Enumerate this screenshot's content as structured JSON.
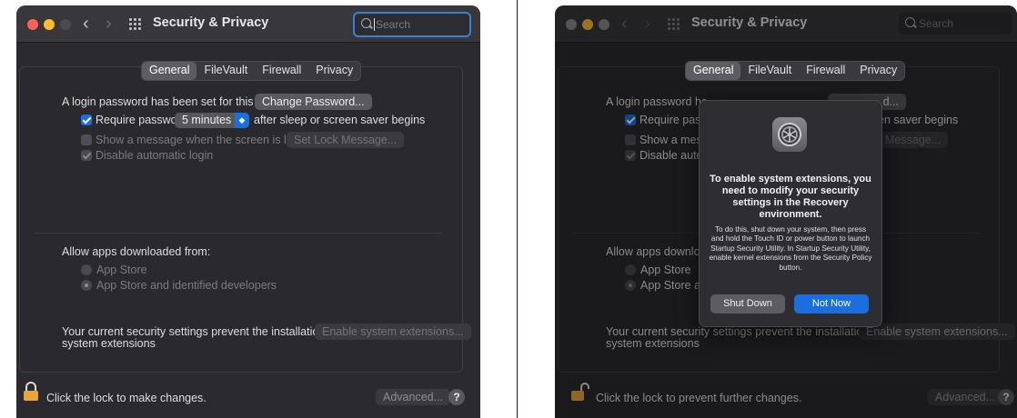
{
  "left": {
    "window_title": "Security & Privacy",
    "search_placeholder": "Search",
    "tabs": [
      "General",
      "FileVault",
      "Firewall",
      "Privacy"
    ],
    "login_text": "A login password has been set for this user",
    "change_password": "Change Password...",
    "require_password": "Require password",
    "require_value": "5 minutes",
    "after_sleep": "after sleep or screen saver begins",
    "show_message": "Show a message when the screen is locked",
    "set_lock_message": "Set Lock Message...",
    "disable_login": "Disable automatic login",
    "allow_apps": "Allow apps downloaded from:",
    "app_store": "App Store",
    "app_store_identified": "App Store and identified developers",
    "prevent_line1": "Your current security settings prevent the installation of",
    "prevent_line2": "system extensions",
    "enable_extensions": "Enable system extensions...",
    "lock_text": "Click the lock to make changes.",
    "advanced": "Advanced...",
    "help": "?"
  },
  "right": {
    "window_title": "Security & Privacy",
    "search_placeholder": "Search",
    "tabs": [
      "General",
      "FileVault",
      "Firewall",
      "Privacy"
    ],
    "login_text": "A login password ha",
    "change_password": "d...",
    "require_password": "Require pass",
    "after_sleep": "en saver begins",
    "show_message": "Show a mess",
    "set_lock_message": "Message...",
    "disable_login": "Disable auto",
    "allow_apps": "Allow apps downloa",
    "app_store": "App Store",
    "app_store_identified": "App Store ar",
    "prevent_line1": "Your current security settings prevent the installation of",
    "prevent_line2": "system extensions",
    "enable_extensions": "Enable system extensions...",
    "lock_text": "Click the lock to prevent further changes.",
    "advanced": "Advanced...",
    "help": "?",
    "dialog": {
      "title": "To enable system extensions, you need to modify your security settings in the Recovery environment.",
      "body": "To do this, shut down your system, then press and hold the Touch ID or power button to launch Startup Security Utility. In Startup Security Utility, enable kernel extensions from the Security Policy button.",
      "shut_down": "Shut Down",
      "not_now": "Not Now"
    }
  }
}
